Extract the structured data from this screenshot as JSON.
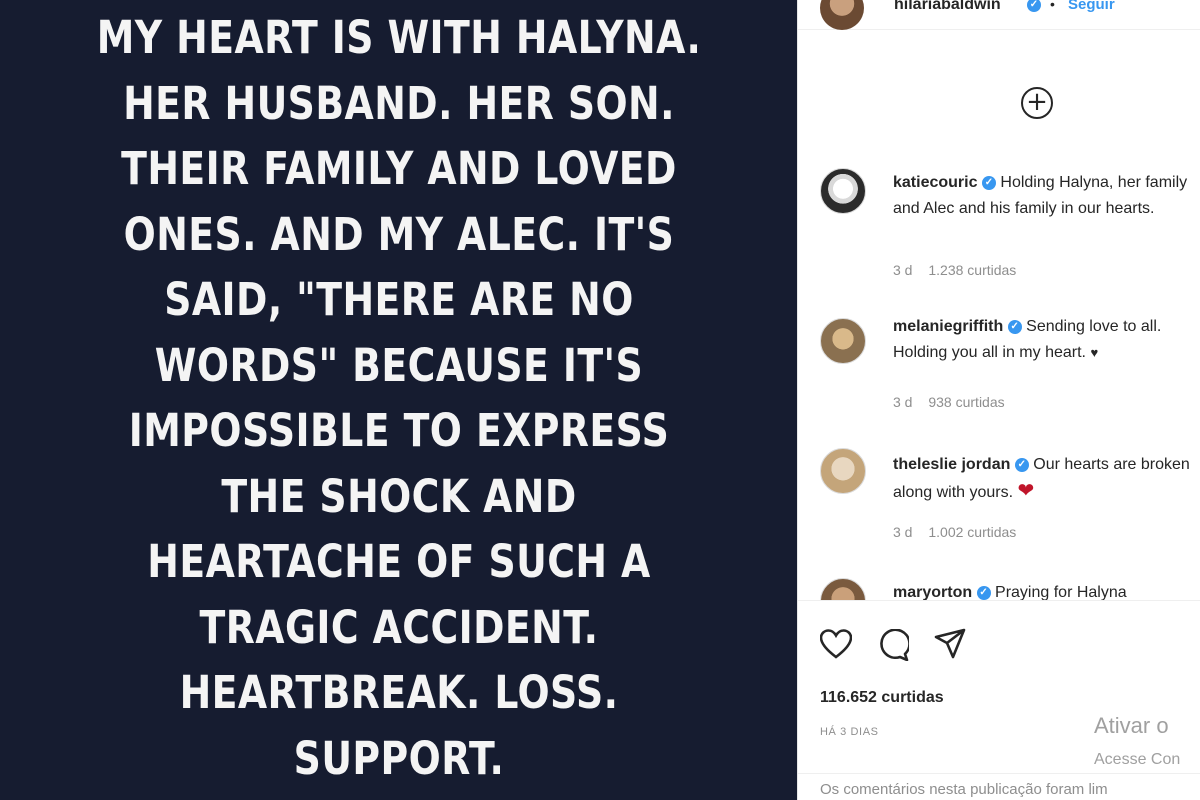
{
  "post": {
    "image_text": "MY HEART IS WITH HALYNA.\nHER HUSBAND. HER SON.\nTHEIR FAMILY AND LOVED\nONES. AND MY ALEC. IT'S\nSAID, \"THERE ARE NO\nWORDS\" BECAUSE IT'S\nIMPOSSIBLE TO EXPRESS\nTHE SHOCK AND\nHEARTACHE OF SUCH A\nTRAGIC ACCIDENT.\nHEARTBREAK. LOSS.\nSUPPORT.",
    "background_color": "#161c30"
  },
  "header": {
    "username": "hilariabaldwin",
    "separator": "•",
    "follow_label": "Seguir"
  },
  "icons": {
    "add": "plus-circle-icon",
    "verified": "verified-badge-icon",
    "like": "heart-icon",
    "comment": "comment-icon",
    "share": "paper-plane-icon"
  },
  "comments": [
    {
      "username": "katiecouric",
      "text": "Holding Halyna, her family and Alec and his family in our hearts.",
      "time": "3 d",
      "likes": "1.238 curtidas"
    },
    {
      "username": "melaniegriffith",
      "text": "Sending love to all. Holding you all in my heart.",
      "emoji": "♥",
      "time": "3 d",
      "likes": "938 curtidas"
    },
    {
      "username": "theleslie jordan",
      "text": "Our hearts are broken along with yours.",
      "emoji": "❤",
      "time": "3 d",
      "likes": "1.002 curtidas"
    },
    {
      "username": "maryorton",
      "text": "Praying for Halyna",
      "time": "",
      "likes": ""
    }
  ],
  "footer": {
    "likes_count": "116.652 curtidas",
    "date": "HÁ 3 DIAS",
    "activate_line1": "Ativar o",
    "activate_line2": "Acesse Con",
    "comments_disabled": "Os comentários nesta publicação foram lim"
  },
  "colors": {
    "accent": "#3897f0",
    "text": "#262626",
    "muted": "#8e8e8e",
    "heart_red": "#c0152a"
  }
}
